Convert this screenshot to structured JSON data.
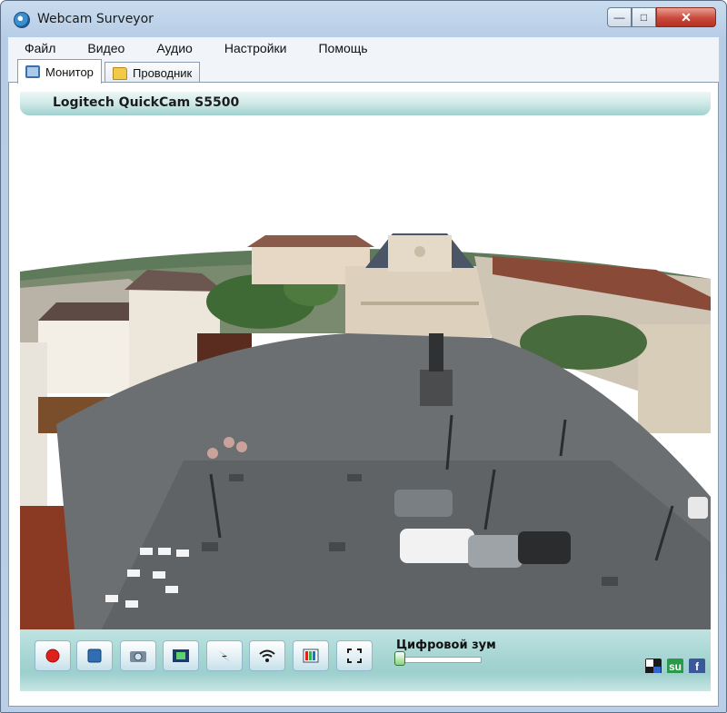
{
  "window": {
    "title": "Webcam Surveyor",
    "close_glyph": "✕",
    "min_glyph": "—",
    "max_glyph": "□"
  },
  "menu": {
    "items": [
      "Файл",
      "Видео",
      "Аудио",
      "Настройки",
      "Помощь"
    ]
  },
  "tabs": [
    {
      "label": "Монитор",
      "icon": "monitor-icon",
      "active": true
    },
    {
      "label": "Проводник",
      "icon": "folder-icon",
      "active": false
    }
  ],
  "camera": {
    "name": "Logitech QuickCam S5500"
  },
  "controls": {
    "buttons": [
      {
        "name": "record-button",
        "icon": "record-icon"
      },
      {
        "name": "stop-button",
        "icon": "stop-icon"
      },
      {
        "name": "snapshot-button",
        "icon": "camera-icon"
      },
      {
        "name": "video-capture-button",
        "icon": "film-icon"
      },
      {
        "name": "motion-detect-button",
        "icon": "lightning-icon"
      },
      {
        "name": "broadcast-button",
        "icon": "wifi-icon"
      },
      {
        "name": "color-settings-button",
        "icon": "color-bars-icon"
      },
      {
        "name": "fullscreen-button",
        "icon": "fullscreen-icon"
      }
    ],
    "zoom_label": "Цифровой зум",
    "zoom_value": 0.0
  },
  "social": [
    {
      "name": "delicious-icon",
      "color": "#1a1a1a"
    },
    {
      "name": "stumbleupon-icon",
      "color": "#2a9a4a",
      "glyph": "su"
    },
    {
      "name": "facebook-icon",
      "color": "#3b5998",
      "glyph": "f"
    }
  ],
  "colors": {
    "accent_teal": "#a8d6d4",
    "record_red": "#e0201a",
    "stop_blue": "#2f6db5"
  }
}
